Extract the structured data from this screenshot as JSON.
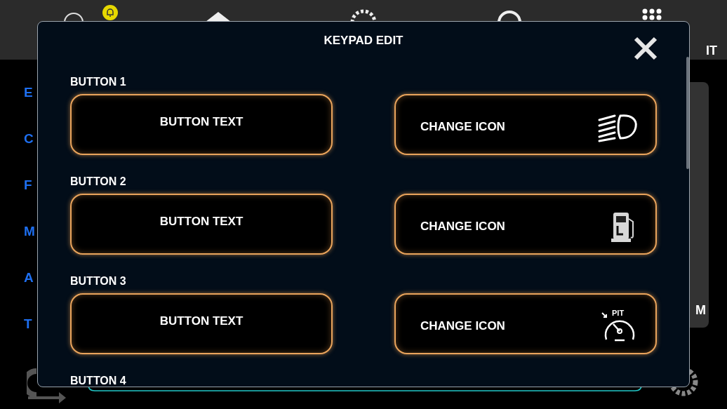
{
  "background": {
    "side_letters": [
      "E",
      "C",
      "F",
      "M",
      "A",
      "T"
    ],
    "top_right_text": "IT",
    "side_panel_text": "M"
  },
  "dialog": {
    "title": "KEYPAD EDIT",
    "rows": [
      {
        "label": "BUTTON 1",
        "text_button": "BUTTON TEXT",
        "icon_button": "CHANGE ICON",
        "icon": {
          "kind": "headlight"
        }
      },
      {
        "label": "BUTTON 2",
        "text_button": "BUTTON TEXT",
        "icon_button": "CHANGE ICON",
        "icon": {
          "kind": "fuel"
        }
      },
      {
        "label": "BUTTON 3",
        "text_button": "BUTTON TEXT",
        "icon_button": "CHANGE ICON",
        "icon": {
          "kind": "pit",
          "text": "PIT"
        }
      },
      {
        "label": "BUTTON 4"
      }
    ]
  }
}
